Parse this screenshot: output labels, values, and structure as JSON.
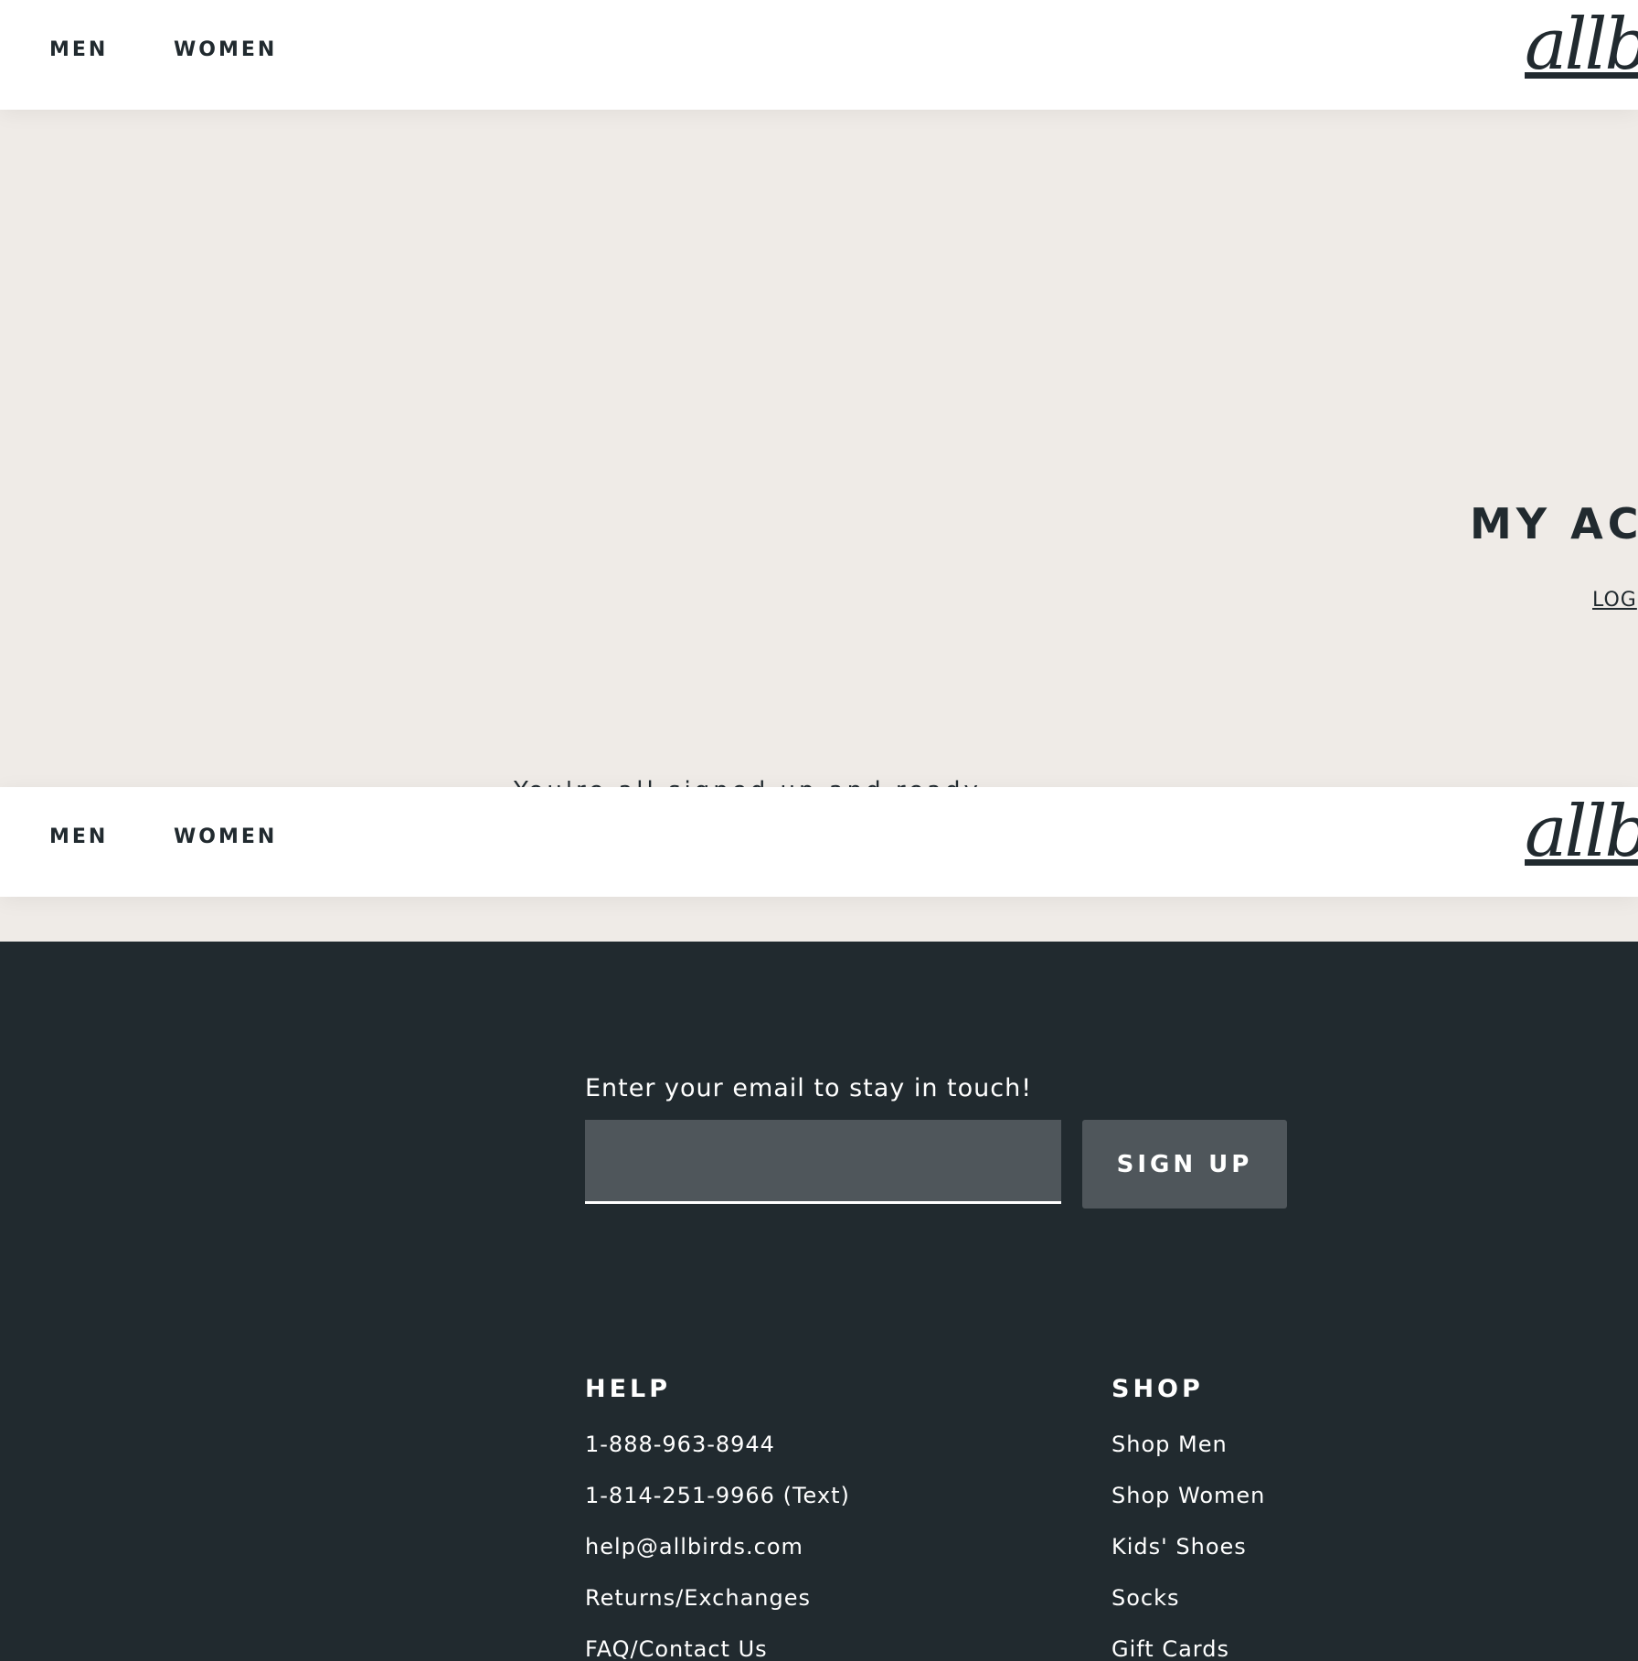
{
  "nav": {
    "men_label": "MEN",
    "women_label": "WOMEN",
    "logo_text": "allb"
  },
  "hero": {
    "title": "MY ACC",
    "logout_label": "LOG",
    "message": "You're all signed up and ready"
  },
  "newsletter": {
    "label": "Enter your email to stay in touch!",
    "email_value": "",
    "button_label": "SIGN UP"
  },
  "footer": {
    "help": {
      "heading": "HELP",
      "links": [
        "1-888-963-8944",
        "1-814-251-9966 (Text)",
        "help@allbirds.com",
        "Returns/Exchanges",
        "FAQ/Contact Us"
      ]
    },
    "shop": {
      "heading": "SHOP",
      "links": [
        "Shop Men",
        "Shop Women",
        "Kids' Shoes",
        "Socks",
        "Gift Cards"
      ]
    }
  },
  "colors": {
    "page_background": "#efebe7",
    "nav_background": "#ffffff",
    "footer_background": "#212a2f",
    "input_background": "#4f565b",
    "text_dark": "#212a2f",
    "text_light": "#ffffff"
  }
}
